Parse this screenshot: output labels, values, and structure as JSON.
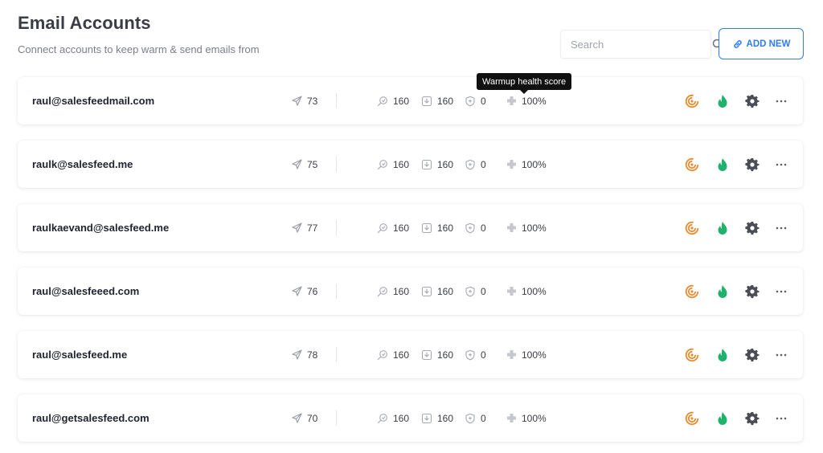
{
  "header": {
    "title": "Email Accounts",
    "subtitle": "Connect accounts to keep warm & send emails from"
  },
  "search": {
    "placeholder": "Search",
    "value": ""
  },
  "add_button": {
    "label": "ADD NEW",
    "icon": "link-icon"
  },
  "tooltip": {
    "text": "Warmup health score"
  },
  "colors": {
    "accent": "#2f7cf6",
    "warm_icon": "#ec8a2b",
    "flame_icon": "#20b16c",
    "gear_icon": "#4a4d55"
  },
  "accounts": [
    {
      "email": "raul@salesfeedmail.com",
      "sent": "73",
      "received": "160",
      "inbox": "160",
      "spam": "0",
      "health": "100%"
    },
    {
      "email": "raulk@salesfeed.me",
      "sent": "75",
      "received": "160",
      "inbox": "160",
      "spam": "0",
      "health": "100%"
    },
    {
      "email": "raulkaevand@salesfeed.me",
      "sent": "77",
      "received": "160",
      "inbox": "160",
      "spam": "0",
      "health": "100%"
    },
    {
      "email": "raul@salesfeeed.com",
      "sent": "76",
      "received": "160",
      "inbox": "160",
      "spam": "0",
      "health": "100%"
    },
    {
      "email": "raul@salesfeed.me",
      "sent": "78",
      "received": "160",
      "inbox": "160",
      "spam": "0",
      "health": "100%"
    },
    {
      "email": "raul@getsalesfeed.com",
      "sent": "70",
      "received": "160",
      "inbox": "160",
      "spam": "0",
      "health": "100%"
    }
  ]
}
